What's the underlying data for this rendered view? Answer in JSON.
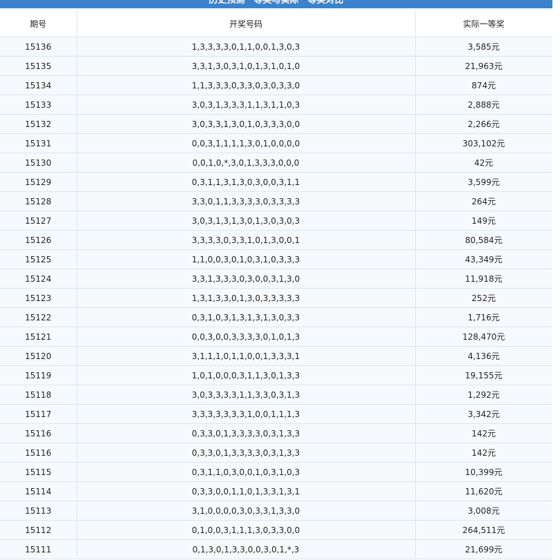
{
  "title": "历史预测一等奖与实际一等奖对比",
  "columns": [
    "期号",
    "开奖号码",
    "实际一等奖"
  ],
  "rows": [
    [
      "15136",
      "1,3,3,3,3,0,1,1,0,0,1,3,0,3",
      "3,585元"
    ],
    [
      "15135",
      "3,3,1,3,0,3,1,0,1,3,1,0,1,0",
      "21,963元"
    ],
    [
      "15134",
      "1,1,3,3,3,0,3,3,0,3,0,3,3,0",
      "874元"
    ],
    [
      "15133",
      "3,0,3,1,3,3,3,1,1,3,1,1,0,3",
      "2,888元"
    ],
    [
      "15132",
      "3,0,3,3,1,3,0,1,0,3,3,3,0,0",
      "2,266元"
    ],
    [
      "15131",
      "0,0,3,1,1,1,1,3,0,1,0,0,0,0",
      "303,102元"
    ],
    [
      "15130",
      "0,0,1,0,*,3,0,1,3,3,3,0,0,0",
      "42元"
    ],
    [
      "15129",
      "0,3,1,1,3,1,3,0,3,0,0,3,1,1",
      "3,599元"
    ],
    [
      "15128",
      "3,3,0,1,1,3,3,3,3,0,3,3,3,3",
      "264元"
    ],
    [
      "15127",
      "3,0,3,1,3,1,3,0,1,3,0,3,0,3",
      "149元"
    ],
    [
      "15126",
      "3,3,3,3,0,3,3,1,0,1,3,0,0,1",
      "80,584元"
    ],
    [
      "15125",
      "1,1,0,0,3,0,1,0,3,1,0,3,3,3",
      "43,349元"
    ],
    [
      "15124",
      "3,3,1,3,3,3,0,3,0,0,3,1,3,0",
      "11,918元"
    ],
    [
      "15123",
      "1,3,1,3,3,0,1,3,0,3,3,3,3,3",
      "252元"
    ],
    [
      "15122",
      "0,3,1,0,3,1,3,1,3,1,3,0,3,3",
      "1,716元"
    ],
    [
      "15121",
      "0,0,3,0,0,3,3,3,3,0,1,0,1,3",
      "128,470元"
    ],
    [
      "15120",
      "3,1,1,1,0,1,1,0,0,1,3,3,3,1",
      "4,136元"
    ],
    [
      "15119",
      "1,0,1,0,0,0,3,1,1,3,0,1,3,3",
      "19,155元"
    ],
    [
      "15118",
      "3,0,3,3,3,3,1,1,3,3,0,3,1,3",
      "1,292元"
    ],
    [
      "15117",
      "3,3,3,3,3,3,3,1,0,0,1,1,1,3",
      "3,342元"
    ],
    [
      "15116",
      "0,3,3,0,1,3,3,3,3,0,3,1,3,3",
      "142元"
    ],
    [
      "15116",
      "0,3,3,0,1,3,3,3,3,0,3,1,3,3",
      "142元"
    ],
    [
      "15115",
      "0,3,1,1,0,3,0,0,1,0,3,1,0,3",
      "10,399元"
    ],
    [
      "15114",
      "0,3,3,0,0,1,1,0,1,3,3,1,3,1",
      "11,620元"
    ],
    [
      "15113",
      "3,1,0,0,0,0,3,0,3,3,1,3,3,0",
      "3,008元"
    ],
    [
      "15112",
      "0,1,0,0,3,1,1,1,3,0,3,3,0,0",
      "264,511元"
    ],
    [
      "15111",
      "0,1,3,0,1,3,3,0,0,3,0,1,*,3",
      "21,699元"
    ]
  ],
  "colors": {
    "title_bg": "#3b82cc",
    "row_bg": "#f7fafd",
    "border": "#dce6f0"
  }
}
